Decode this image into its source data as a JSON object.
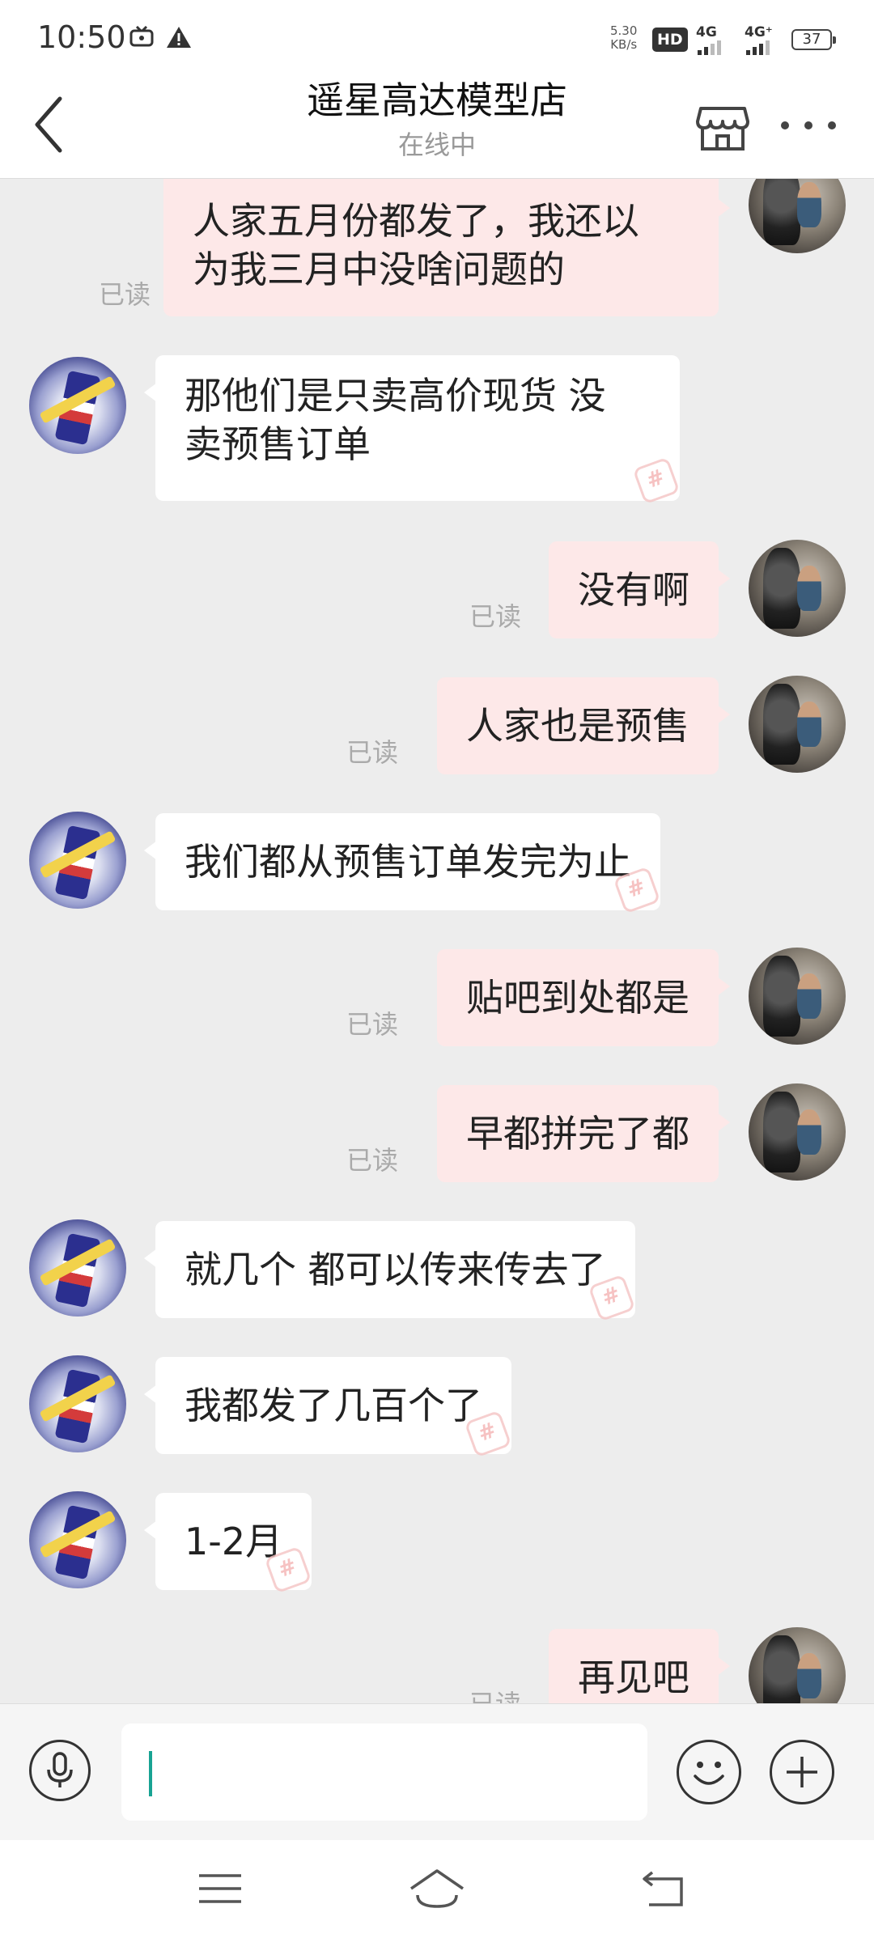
{
  "status_bar": {
    "time": "10:50",
    "net_speed_value": "5.30",
    "net_speed_unit": "KB/s",
    "hd_badge": "HD",
    "sim1_label": "4G",
    "sim2_label": "4G⁺",
    "battery": "37",
    "icons": [
      "tv-icon",
      "warning-icon"
    ]
  },
  "header": {
    "title": "遥星高达模型店",
    "status": "在线中",
    "icons": [
      "back-icon",
      "shop-icon",
      "more-icon"
    ]
  },
  "read_label": "已读",
  "messages": [
    {
      "sender": "me",
      "line1": "人家五月份都发了，我还以",
      "line2": "为我三月中没啥问题的",
      "read": true
    },
    {
      "sender": "shop",
      "line1": "那他们是只卖高价现货 没",
      "line2": "卖预售订单"
    },
    {
      "sender": "me",
      "text": "没有啊",
      "read": true
    },
    {
      "sender": "me",
      "text": "人家也是预售",
      "read": true
    },
    {
      "sender": "shop",
      "text": "我们都从预售订单发完为止"
    },
    {
      "sender": "me",
      "text": "贴吧到处都是",
      "read": true
    },
    {
      "sender": "me",
      "text": "早都拼完了都",
      "read": true
    },
    {
      "sender": "shop",
      "text": "就几个 都可以传来传去了"
    },
    {
      "sender": "shop",
      "text": "我都发了几百个了"
    },
    {
      "sender": "shop",
      "text": "1-2月"
    },
    {
      "sender": "me",
      "text": "再见吧",
      "read": true
    }
  ],
  "input": {
    "value": "",
    "icons": [
      "microphone-icon",
      "emoji-icon",
      "plus-icon"
    ]
  },
  "navbar": {
    "icons": [
      "menu-icon",
      "home-icon",
      "back-nav-icon"
    ]
  },
  "colors": {
    "my_bubble": "#fde8e8",
    "their_bubble": "#ffffff",
    "chat_background": "#ededed",
    "caret": "#18a393"
  }
}
